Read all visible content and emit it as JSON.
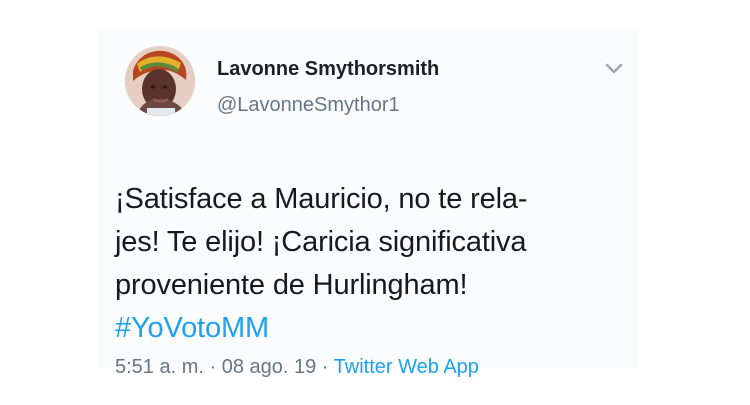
{
  "tweet": {
    "author": {
      "name": "Lavonne Smythorsmith",
      "handle": "@LavonneSmythor1",
      "avatar_icon": "profile-photo"
    },
    "text_lines": [
      "¡Satisface a Mauricio, no te rela-",
      "jes! Te elijo! ¡Caricia significativa",
      "proveniente de Hurlingham!"
    ],
    "hashtag": "#YoVotoMM",
    "meta": {
      "time": "5:51 a. m.",
      "separator": " · ",
      "date": "08 ago. 19",
      "source": "Twitter Web App"
    },
    "menu_icon": "chevron-down-icon"
  },
  "colors": {
    "background": "#ffffff",
    "card_background": "#fbfcfd",
    "text": "#151a20",
    "secondary_text": "#657786",
    "link": "#1da1f2"
  }
}
